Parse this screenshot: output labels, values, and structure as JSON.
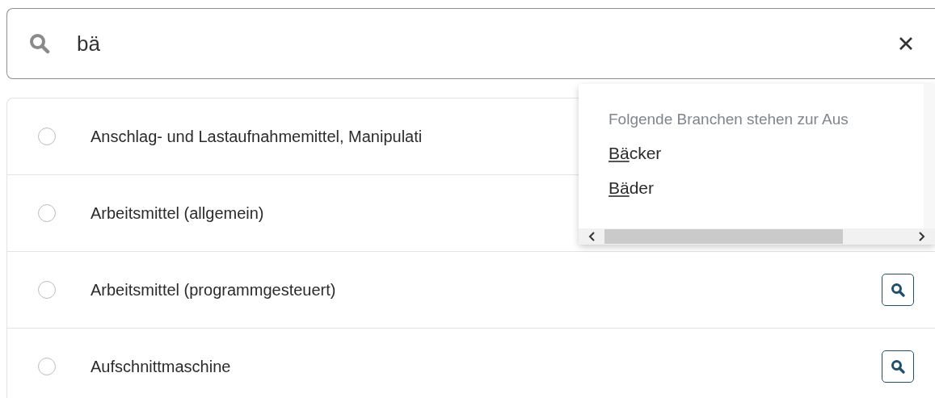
{
  "search": {
    "value": "bä"
  },
  "rows": [
    {
      "label": "Anschlag- und Lastaufnahmemittel, Manipulati",
      "selected": false
    },
    {
      "label": "Arbeitsmittel (allgemein)",
      "selected": false
    },
    {
      "label": "Arbeitsmittel (programmgesteuert)",
      "selected": false
    },
    {
      "label": "Aufschnittmaschine",
      "selected": false
    }
  ],
  "suggestions": {
    "hint": "Folgende Branchen stehen zur Aus",
    "options": [
      {
        "match": "Bä",
        "rest": "cker"
      },
      {
        "match": "Bä",
        "rest": "der"
      }
    ]
  }
}
